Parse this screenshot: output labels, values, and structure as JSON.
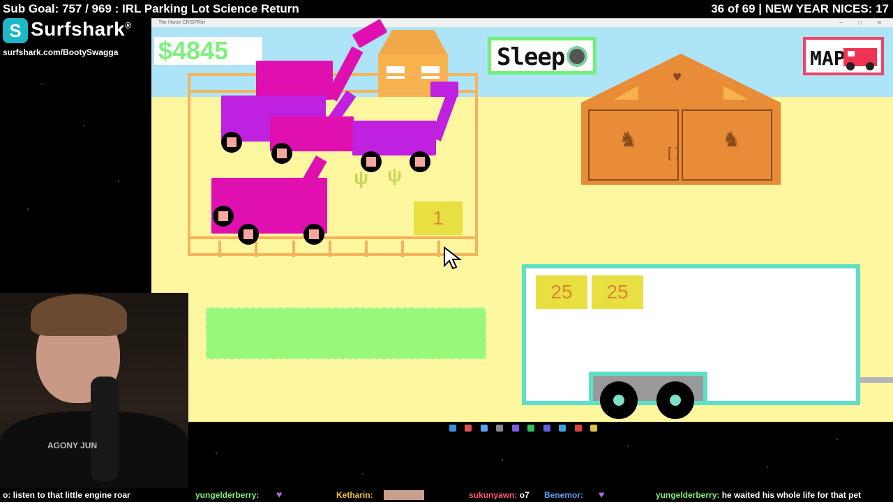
{
  "stream": {
    "sub_goal": "Sub Goal: 757 / 969 : IRL Parking Lot Science Return",
    "counter": "36 of 69 | NEW YEAR NICES: 17"
  },
  "sponsor": {
    "logo_letter": "S",
    "name": "Surfshark",
    "trademark": "®",
    "url": "surfshark.com/BootySwagga"
  },
  "window": {
    "title": "The Horse CRISPRer",
    "controls": "–  □  ✕"
  },
  "game": {
    "money": "$4845",
    "sleep_label": "Sleep",
    "map_label": "MAP",
    "paddock_count": "1",
    "trailer_prices": [
      "25",
      "25"
    ],
    "barn_bracket": "[ ]",
    "colors": {
      "sky": "#aee4f8",
      "ground": "#fff6a0",
      "fence": "#f5b45a",
      "horse_magenta": "#e010b0",
      "horse_purple": "#c020e0",
      "trailer_border": "#5ee0c8",
      "button_green": "#98f878",
      "money_green": "#7ef07e",
      "map_border": "#ee4466",
      "barn": "#e88c38"
    }
  },
  "webcam": {
    "shirt_text": "AGONY JUN"
  },
  "chat": [
    {
      "user": "o:",
      "message": "listen to that little engine roar"
    },
    {
      "user": "yungelderberry:",
      "message": ""
    },
    {
      "user": "Ketharin:",
      "message": ""
    },
    {
      "user": "sukunyawn:",
      "message": "o7"
    },
    {
      "user": "Benemor:",
      "message": ""
    },
    {
      "user": "yungelderberry:",
      "message": "he waited his whole life for that pet"
    }
  ]
}
